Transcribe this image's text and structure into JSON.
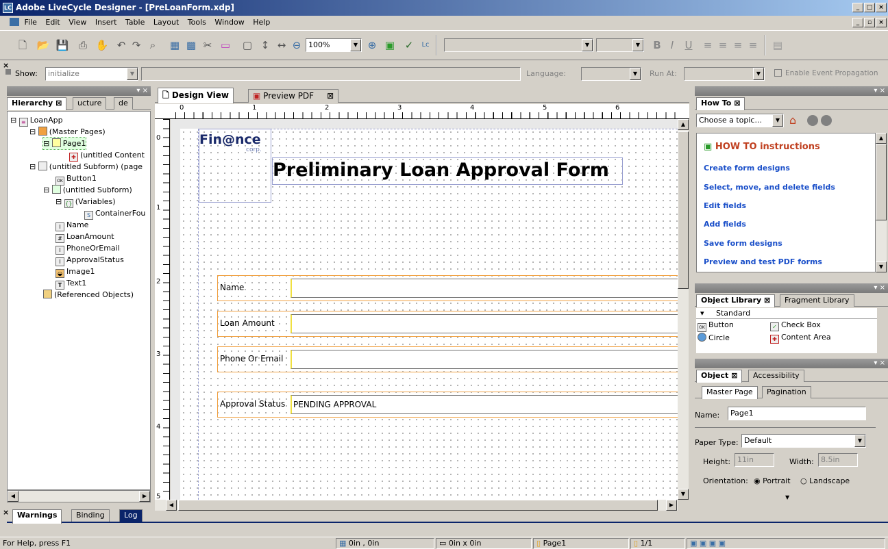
{
  "window": {
    "title": "Adobe LiveCycle Designer - [PreLoanForm.xdp]",
    "app_icon": "LC"
  },
  "menu": [
    "File",
    "Edit",
    "View",
    "Insert",
    "Table",
    "Layout",
    "Tools",
    "Window",
    "Help"
  ],
  "toolbar": {
    "zoom": "100%",
    "bold": "B",
    "italic": "I",
    "underline": "U"
  },
  "script_bar": {
    "show_label": "Show:",
    "show_value": "initialize",
    "language_label": "Language:",
    "run_at_label": "Run At:",
    "event_propagation_label": "Enable Event Propagation"
  },
  "hierarchy": {
    "tabs": [
      "Hierarchy",
      "ucture",
      "de"
    ],
    "nodes": [
      "LoanApp",
      "(Master Pages)",
      "Page1",
      "(untitled Content",
      "(untitled Subform) (page",
      "Button1",
      "(untitled Subform)",
      "(Variables)",
      "ContainerFou",
      "Name",
      "LoanAmount",
      "PhoneOrEmail",
      "ApprovalStatus",
      "Image1",
      "Text1",
      "(Referenced Objects)"
    ]
  },
  "doc_tabs": {
    "design": "Design View",
    "preview": "Preview PDF"
  },
  "ruler": {
    "h": [
      "0",
      "1",
      "2",
      "3",
      "4",
      "5",
      "6"
    ],
    "v": [
      "0",
      "1",
      "2",
      "3",
      "4",
      "5"
    ]
  },
  "form": {
    "logo_main": "Fin@nce",
    "logo_sub": "corp.",
    "title": "Preliminary Loan Approval Form",
    "fields": [
      {
        "caption": "Name",
        "value": ""
      },
      {
        "caption": "Loan Amount",
        "value": ""
      },
      {
        "caption": "Phone Or Email",
        "value": ""
      },
      {
        "caption": "Approval Status",
        "value": "PENDING APPROVAL"
      }
    ]
  },
  "howto": {
    "tab": "How To",
    "topic": "Choose a topic...",
    "heading": "HOW TO instructions",
    "links": [
      "Create form designs",
      "Select, move, and delete fields",
      "Edit fields",
      "Add fields",
      "Save form designs",
      "Preview and test PDF forms"
    ]
  },
  "library": {
    "tabs": [
      "Object Library",
      "Fragment Library"
    ],
    "category": "Standard",
    "items": [
      "Button",
      "Check Box",
      "Circle",
      "Content Area"
    ]
  },
  "object": {
    "tabs": [
      "Object",
      "Accessibility"
    ],
    "subtabs": [
      "Master Page",
      "Pagination"
    ],
    "name_label": "Name:",
    "name_value": "Page1",
    "paper_label": "Paper Type:",
    "paper_value": "Default",
    "height_label": "Height:",
    "height_value": "11in",
    "width_label": "Width:",
    "width_value": "8.5in",
    "orientation_label": "Orientation:",
    "portrait": "Portrait",
    "landscape": "Landscape"
  },
  "bottom_tabs": [
    "Warnings",
    "Binding",
    "Log"
  ],
  "status": {
    "help": "For Help, press F1",
    "pos": "0in , 0in",
    "size": "0in x 0in",
    "page": "Page1",
    "count": "1/1"
  }
}
